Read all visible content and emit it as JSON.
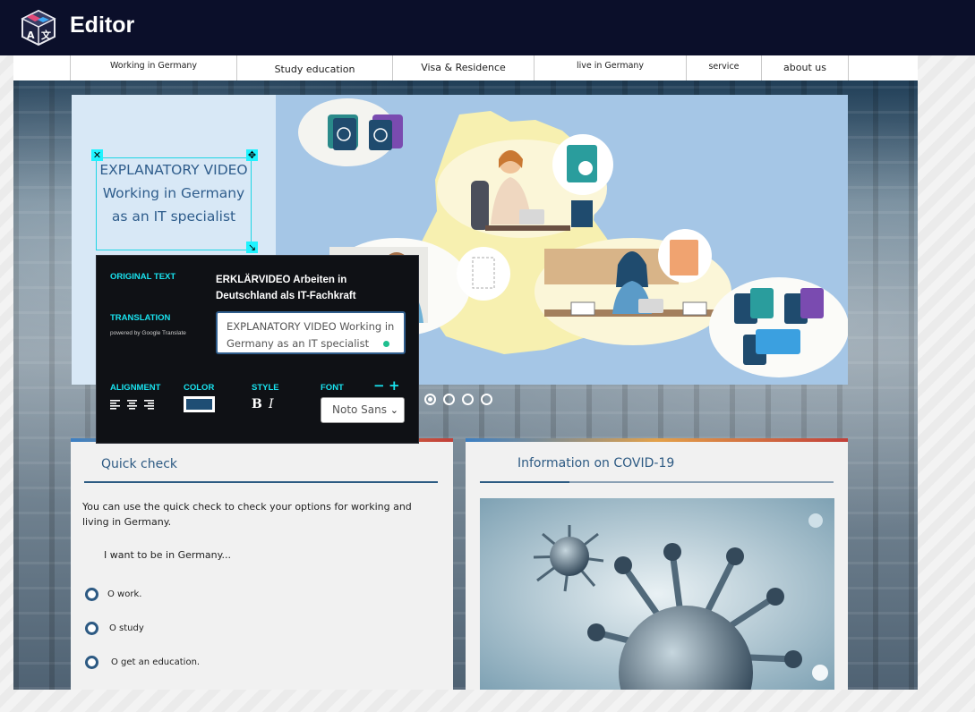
{
  "app": {
    "title": "Editor",
    "logo_icon": "translate-cube-icon"
  },
  "nav": {
    "items": [
      "Working in Germany",
      "Study education",
      "Visa & Residence",
      "live in Germany",
      "service",
      "about us"
    ]
  },
  "hero": {
    "text_line1": "EXPLANATORY VIDEO",
    "text_line2": "Working in Germany",
    "text_line3": "as an IT specialist",
    "carousel_slides": 4,
    "carousel_active": 1
  },
  "popup": {
    "original_label": "ORIGINAL TEXT",
    "original_text": "ERKLÄRVIDEO Arbeiten in Deutschland als IT-Fachkraft",
    "translation_label": "TRANSLATION",
    "powered_by": "powered by Google Translate",
    "translation_value": "EXPLANATORY VIDEO Working in Germany as an IT specialist",
    "alignment_label": "ALIGNMENT",
    "color_label": "COLOR",
    "style_label": "STYLE",
    "font_label": "FONT",
    "font_value": "Noto Sans",
    "font_minus": "−",
    "font_plus": "+",
    "bold": "B",
    "italic": "I",
    "color_value": "#1e4d74"
  },
  "quick_check": {
    "title": "Quick check",
    "description": "You can use the quick check to check your options for working and living in Germany.",
    "question": "I want to be in Germany...",
    "options": [
      "O work.",
      "O study",
      "O get an education."
    ]
  },
  "covid": {
    "title": "Information on COVID-19"
  },
  "colors": {
    "topbar": "#0b0f2a",
    "accent": "#19e3ef",
    "brand_blue": "#2d5a83"
  }
}
